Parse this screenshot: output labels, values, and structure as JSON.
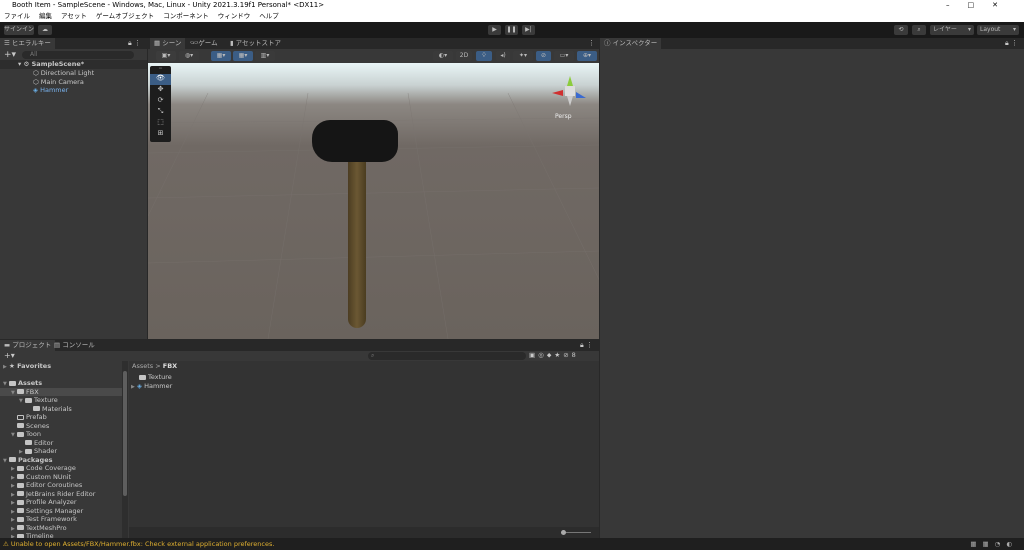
{
  "window": {
    "title": "Booth Item - SampleScene - Windows, Mac, Linux - Unity 2021.3.19f1 Personal* <DX11>"
  },
  "menu": [
    "ファイル",
    "編集",
    "アセット",
    "ゲームオブジェクト",
    "コンポーネント",
    "ウィンドウ",
    "ヘルプ"
  ],
  "toolbar": {
    "signin": "サインイン",
    "layers": "レイヤー",
    "layout": "Layout"
  },
  "hierarchy": {
    "tab": "ヒエラルキー",
    "search_placeholder": "All",
    "scene": "SampleScene*",
    "items": [
      "Directional Light",
      "Main Camera",
      "Hammer"
    ]
  },
  "scene_tabs": [
    "シーン",
    "ゲーム",
    "アセットストア"
  ],
  "scene": {
    "btn_2d": "2D",
    "persp": "Persp"
  },
  "inspector": {
    "tab": "インスペクター"
  },
  "bottom_tabs": [
    "プロジェクト",
    "コンソール"
  ],
  "project": {
    "favorites": "Favorites",
    "tree": [
      {
        "label": "Assets",
        "depth": 0,
        "bold": true
      },
      {
        "label": "FBX",
        "depth": 1
      },
      {
        "label": "Texture",
        "depth": 2
      },
      {
        "label": "Materials",
        "depth": 3
      },
      {
        "label": "Prefab",
        "depth": 1
      },
      {
        "label": "Scenes",
        "depth": 1
      },
      {
        "label": "Toon",
        "depth": 1
      },
      {
        "label": "Editor",
        "depth": 2
      },
      {
        "label": "Shader",
        "depth": 2
      },
      {
        "label": "Packages",
        "depth": 0,
        "bold": true
      },
      {
        "label": "Code Coverage",
        "depth": 1
      },
      {
        "label": "Custom NUnit",
        "depth": 1
      },
      {
        "label": "Editor Coroutines",
        "depth": 1
      },
      {
        "label": "JetBrains Rider Editor",
        "depth": 1
      },
      {
        "label": "Profile Analyzer",
        "depth": 1
      },
      {
        "label": "Settings Manager",
        "depth": 1
      },
      {
        "label": "Test Framework",
        "depth": 1
      },
      {
        "label": "TextMeshPro",
        "depth": 1
      },
      {
        "label": "Timeline",
        "depth": 1
      }
    ],
    "breadcrumb": [
      "Assets",
      "FBX"
    ],
    "contents": [
      "Texture",
      "Hammer"
    ],
    "hidden_count": "8"
  },
  "status": {
    "message": "Unable to open Assets/FBX/Hammer.fbx: Check external application preferences."
  }
}
